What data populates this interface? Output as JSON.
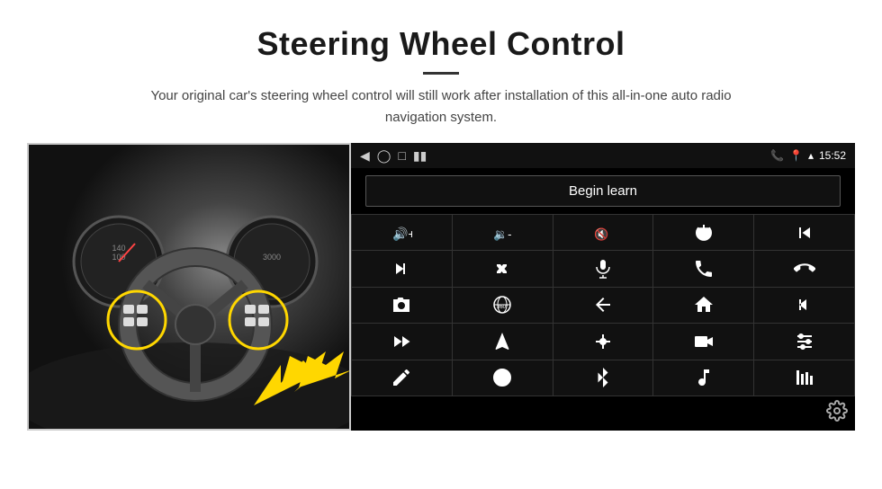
{
  "header": {
    "title": "Steering Wheel Control",
    "divider": true,
    "subtitle": "Your original car's steering wheel control will still work after installation of this all-in-one auto radio navigation system."
  },
  "statusbar": {
    "time": "15:52",
    "icons": [
      "back-icon",
      "home-circle-icon",
      "square-icon",
      "signal-icon",
      "phone-icon",
      "location-icon",
      "wifi-icon"
    ]
  },
  "begin_learn": {
    "button_label": "Begin learn"
  },
  "controls": [
    {
      "id": "vol-up",
      "symbol": "🔊+",
      "name": "volume-up"
    },
    {
      "id": "vol-down",
      "symbol": "🔉−",
      "name": "volume-down"
    },
    {
      "id": "mute",
      "symbol": "🔇",
      "name": "mute"
    },
    {
      "id": "power",
      "symbol": "⏻",
      "name": "power"
    },
    {
      "id": "prev-track",
      "symbol": "⏮",
      "name": "previous-track"
    },
    {
      "id": "skip-next",
      "symbol": "⏭",
      "name": "skip-next"
    },
    {
      "id": "shuffle",
      "symbol": "⇌",
      "name": "shuffle"
    },
    {
      "id": "mic",
      "symbol": "🎤",
      "name": "microphone"
    },
    {
      "id": "phone",
      "symbol": "📞",
      "name": "phone"
    },
    {
      "id": "hang-up",
      "symbol": "📵",
      "name": "hang-up"
    },
    {
      "id": "camera",
      "symbol": "📷",
      "name": "camera"
    },
    {
      "id": "360view",
      "symbol": "360°",
      "name": "360-view"
    },
    {
      "id": "back",
      "symbol": "↩",
      "name": "back-nav"
    },
    {
      "id": "home",
      "symbol": "⌂",
      "name": "home-nav"
    },
    {
      "id": "prev-chapter",
      "symbol": "⏮⏮",
      "name": "previous-chapter"
    },
    {
      "id": "fast-fwd",
      "symbol": "⏩",
      "name": "fast-forward"
    },
    {
      "id": "navigate",
      "symbol": "▶",
      "name": "navigate"
    },
    {
      "id": "eq",
      "symbol": "⇌",
      "name": "equalizer"
    },
    {
      "id": "record",
      "symbol": "📹",
      "name": "record"
    },
    {
      "id": "settings-ctrl",
      "symbol": "⚙",
      "name": "settings-control"
    },
    {
      "id": "edit",
      "symbol": "✎",
      "name": "edit"
    },
    {
      "id": "disc",
      "symbol": "⊙",
      "name": "disc"
    },
    {
      "id": "bluetooth",
      "symbol": "⚡",
      "name": "bluetooth"
    },
    {
      "id": "music",
      "symbol": "♪",
      "name": "music"
    },
    {
      "id": "equalizer2",
      "symbol": "|||",
      "name": "equalizer2"
    }
  ],
  "settings": {
    "icon_label": "settings-gear-icon"
  }
}
